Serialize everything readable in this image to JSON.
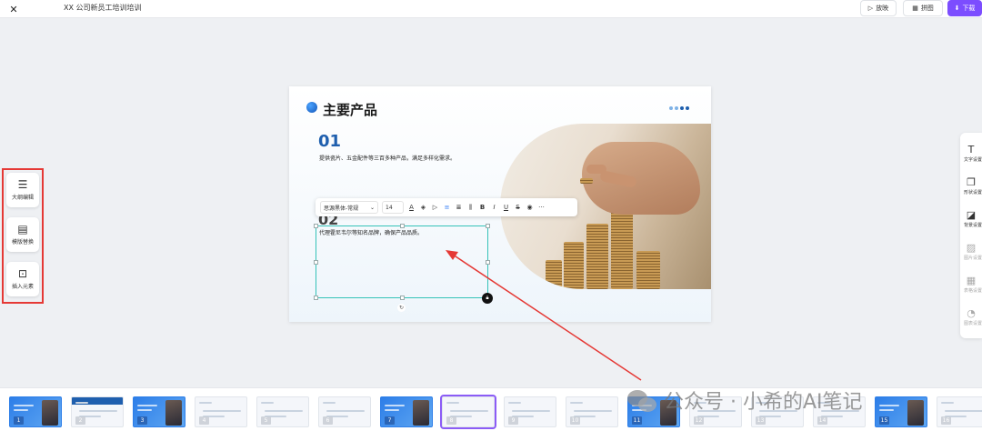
{
  "topbar": {
    "title": "XX 公司新员工培训培训",
    "play_label": "放映",
    "grid_label": "拼图",
    "download_label": "下载"
  },
  "left_tools": [
    {
      "label": "大纲编辑",
      "icon": "outline-icon"
    },
    {
      "label": "模版替换",
      "icon": "template-icon"
    },
    {
      "label": "插入元素",
      "icon": "insert-icon"
    }
  ],
  "right_tools": [
    {
      "label": "文字设置",
      "icon": "text-icon",
      "enabled": true
    },
    {
      "label": "形状设置",
      "icon": "shape-icon",
      "enabled": true
    },
    {
      "label": "背景设置",
      "icon": "background-icon",
      "enabled": true
    },
    {
      "label": "图片设置",
      "icon": "image-icon",
      "enabled": false
    },
    {
      "label": "表格设置",
      "icon": "table-icon",
      "enabled": false
    },
    {
      "label": "图表设置",
      "icon": "chart-icon",
      "enabled": false
    }
  ],
  "slide": {
    "title": "主要产品",
    "item1_number": "01",
    "item1_text": "提供瓷片、五金配件等三百多种产品，满足多样化需求。",
    "item2_number": "02",
    "item2_text": "代理霍尼韦尔等知名品牌，确保产品品质。"
  },
  "text_toolbar": {
    "font_family": "思源黑体-常规",
    "font_size": "14"
  },
  "thumbnails": [
    {
      "num": "1",
      "style": "blue"
    },
    {
      "num": "2",
      "style": "light"
    },
    {
      "num": "3",
      "style": "blue"
    },
    {
      "num": "4",
      "style": "light"
    },
    {
      "num": "5",
      "style": "light"
    },
    {
      "num": "6",
      "style": "light"
    },
    {
      "num": "7",
      "style": "blue"
    },
    {
      "num": "8",
      "style": "light",
      "selected": true
    },
    {
      "num": "9",
      "style": "light"
    },
    {
      "num": "10",
      "style": "light"
    },
    {
      "num": "11",
      "style": "blue"
    },
    {
      "num": "12",
      "style": "light"
    },
    {
      "num": "13",
      "style": "light"
    },
    {
      "num": "14",
      "style": "light"
    },
    {
      "num": "15",
      "style": "blue"
    },
    {
      "num": "16",
      "style": "light"
    }
  ],
  "watermark": "公众号 · 小希的AI笔记",
  "colors": {
    "accent": "#7c4dff",
    "highlight_red": "#e53935",
    "selection": "#35c2b8",
    "slide_blue": "#1f5fae"
  }
}
